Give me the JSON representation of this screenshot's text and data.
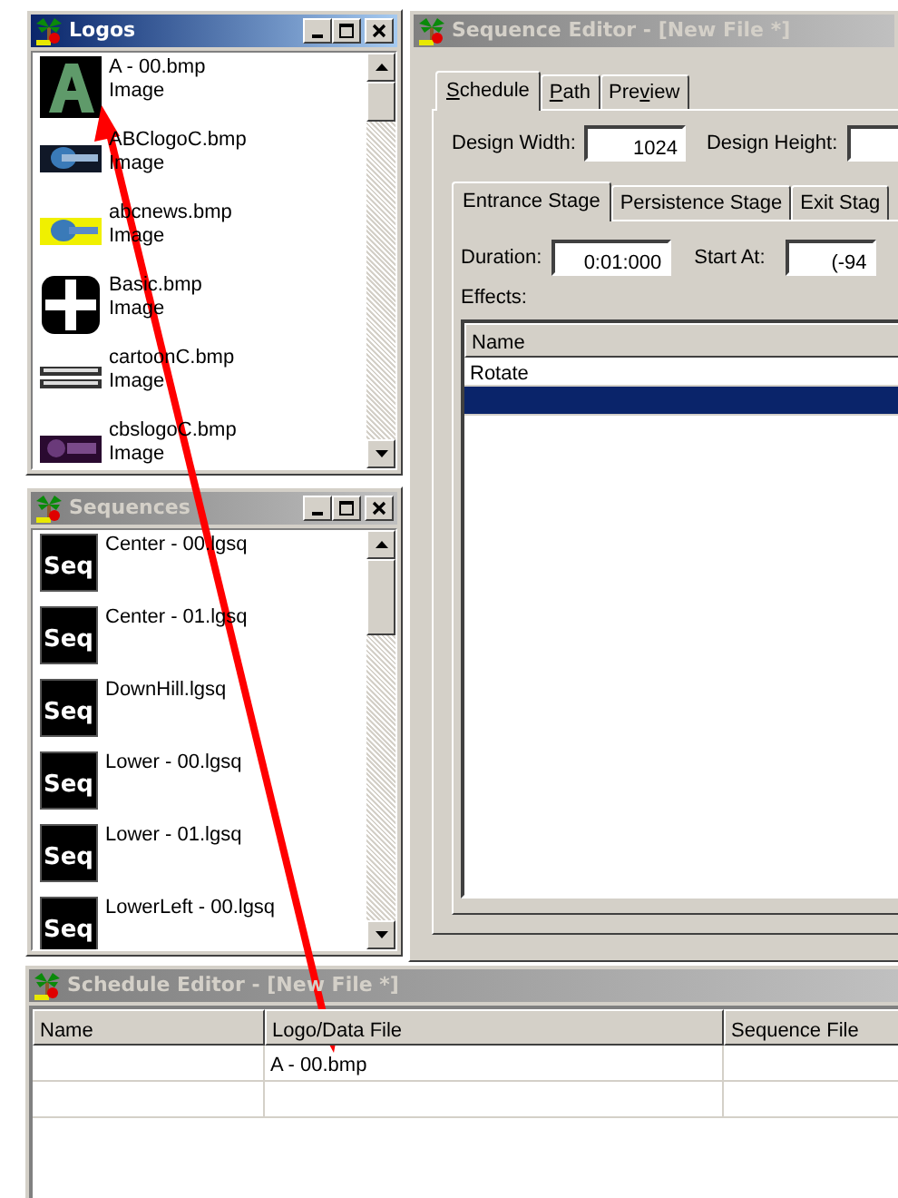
{
  "logos": {
    "title": "Logos",
    "active": true,
    "items": [
      {
        "name": "A - 00.bmp",
        "type": "Image"
      },
      {
        "name": "ABClogoC.bmp",
        "type": "Image"
      },
      {
        "name": "abcnews.bmp",
        "type": "Image"
      },
      {
        "name": "Basic.bmp",
        "type": "Image"
      },
      {
        "name": "cartoonC.bmp",
        "type": "Image"
      },
      {
        "name": "cbslogoC.bmp",
        "type": "Image"
      }
    ]
  },
  "sequences": {
    "title": "Sequences",
    "active": false,
    "items": [
      {
        "name": "Center - 00.lgsq",
        "icon_text": "Seq"
      },
      {
        "name": "Center - 01.lgsq",
        "icon_text": "Seq"
      },
      {
        "name": "DownHill.lgsq",
        "icon_text": "Seq"
      },
      {
        "name": "Lower - 00.lgsq",
        "icon_text": "Seq"
      },
      {
        "name": "Lower - 01.lgsq",
        "icon_text": "Seq"
      },
      {
        "name": "LowerLeft - 00.lgsq",
        "icon_text": "Seq"
      }
    ]
  },
  "sequence_editor": {
    "title": "Sequence Editor - [New File *]",
    "active": false,
    "tabs": [
      {
        "access_key": "S",
        "rest": "chedule",
        "selected": true
      },
      {
        "access_key": "P",
        "rest": "ath",
        "selected": false
      },
      {
        "lead": "Pre",
        "access_key": "v",
        "rest": "iew",
        "selected": false
      }
    ],
    "design_width": {
      "label": "Design Width:",
      "value": "1024"
    },
    "design_height": {
      "label": "Design Height:"
    },
    "stage_tabs": [
      {
        "label": "Entrance Stage",
        "selected": true
      },
      {
        "label": "Persistence Stage",
        "selected": false
      },
      {
        "label": "Exit Stag",
        "selected": false
      }
    ],
    "duration": {
      "label": "Duration:",
      "value": "0:01:000"
    },
    "start_at": {
      "label": "Start At:",
      "value": "(-94"
    },
    "effects": {
      "label": "Effects:",
      "columns": [
        "Name"
      ],
      "rows": [
        {
          "name": "Rotate",
          "selected": false
        },
        {
          "selected": true
        }
      ]
    }
  },
  "schedule_editor": {
    "title": "Schedule Editor - [New File *]",
    "active": false,
    "columns": [
      "Name",
      "Logo/Data File",
      "Sequence File"
    ],
    "rows": [
      {
        "logo_file": "A - 00.bmp"
      }
    ]
  }
}
